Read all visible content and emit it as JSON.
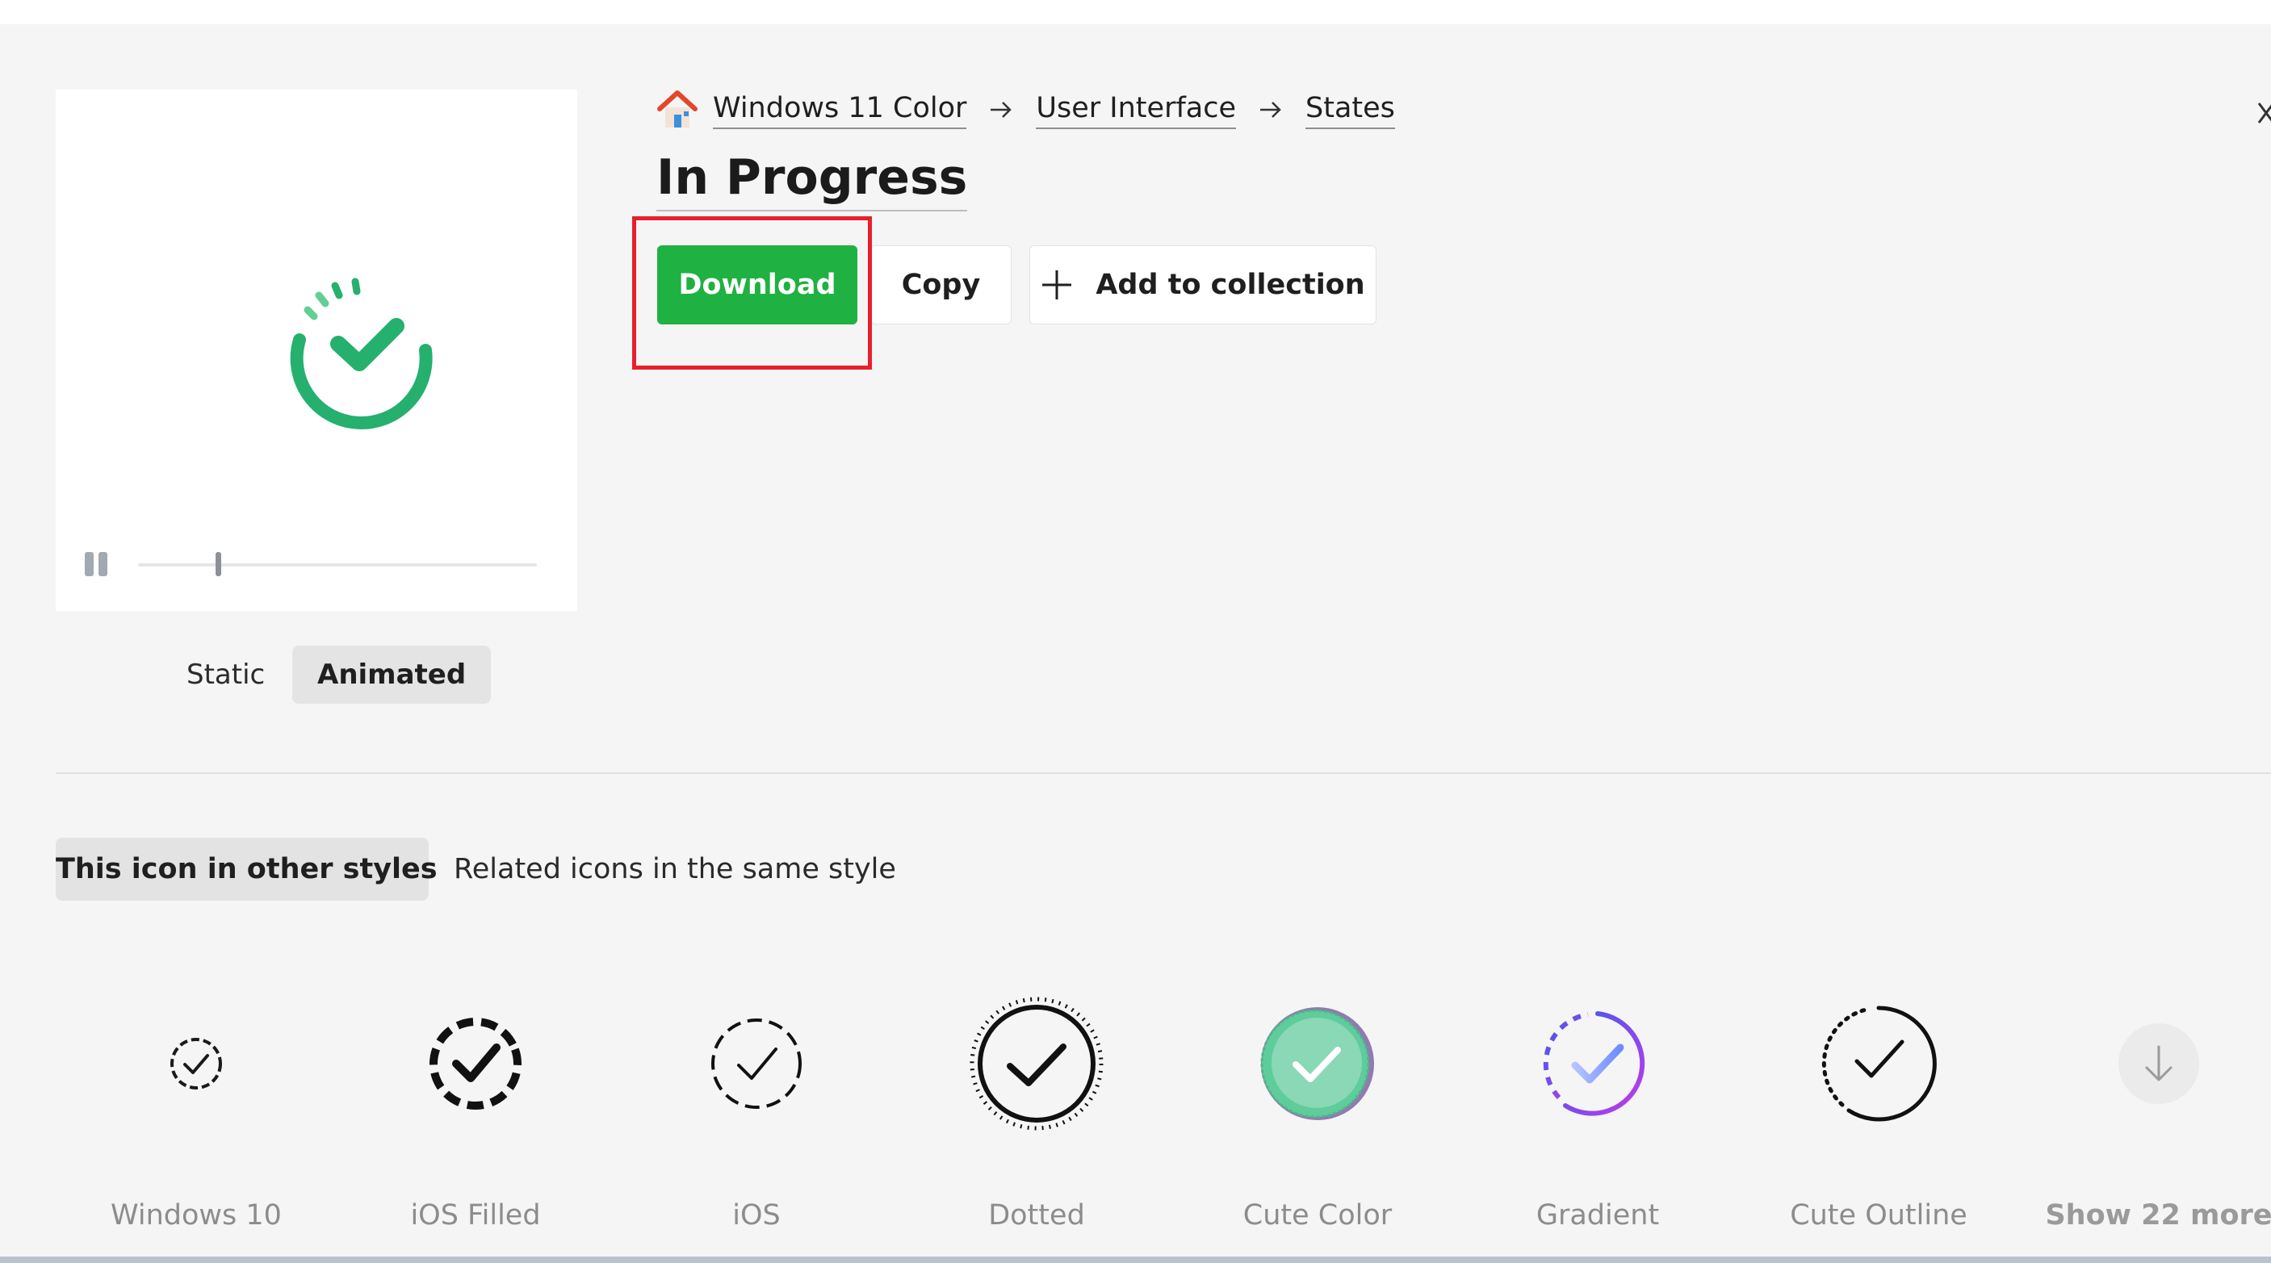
{
  "breadcrumb": {
    "items": [
      "Windows 11 Color",
      "User Interface",
      "States"
    ]
  },
  "title": "In Progress",
  "actions": {
    "download": "Download",
    "copy": "Copy",
    "add_to_collection": "Add to collection"
  },
  "preview": {
    "playback_progress": 0.2,
    "modes": [
      "Static",
      "Animated"
    ],
    "selected_mode": "Animated",
    "icon_colors": {
      "primary": "#25b06d",
      "light": "#62cf94"
    }
  },
  "tabs": {
    "other_styles": "This icon in other styles",
    "related": "Related icons in the same style",
    "selected": "This icon in other styles"
  },
  "styles": [
    {
      "label": "Windows 10",
      "icon": "check-circle-dashed-small-icon"
    },
    {
      "label": "iOS Filled",
      "icon": "check-circle-dashed-bold-icon"
    },
    {
      "label": "iOS",
      "icon": "check-circle-dashed-icon"
    },
    {
      "label": "Dotted",
      "icon": "check-circle-dotted-icon"
    },
    {
      "label": "Cute Color",
      "icon": "check-circle-cute-color-icon"
    },
    {
      "label": "Gradient",
      "icon": "check-circle-gradient-icon"
    },
    {
      "label": "Cute Outline",
      "icon": "check-circle-cute-outline-icon"
    }
  ],
  "show_more": "Show 22 more",
  "colors": {
    "accent": "#1fb141",
    "highlight": "#e8202a",
    "background": "#f5f5f5"
  }
}
